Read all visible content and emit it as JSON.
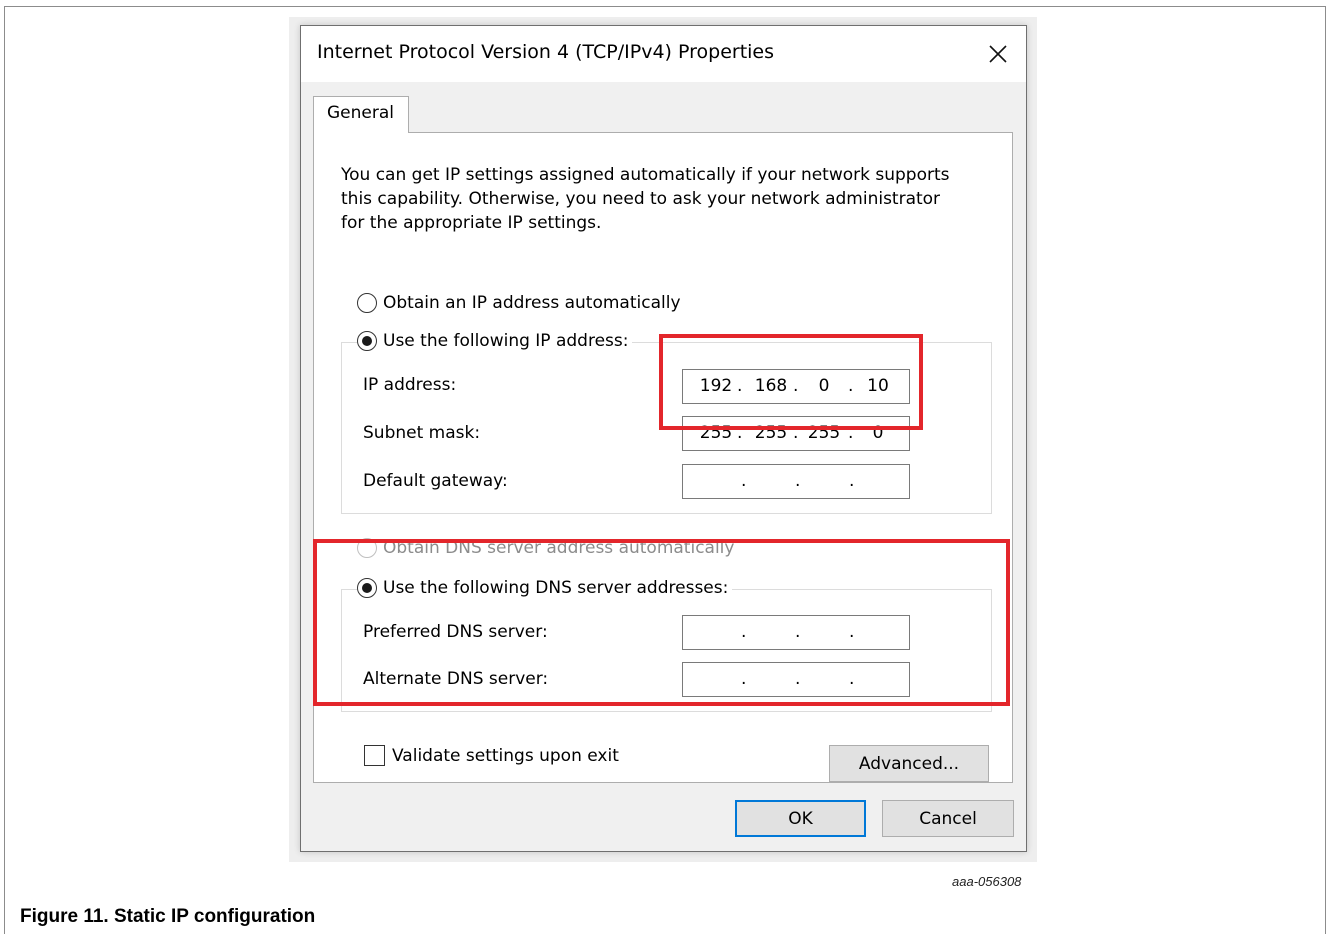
{
  "dialog": {
    "title": "Internet Protocol Version 4 (TCP/IPv4) Properties",
    "close_icon": "close-icon",
    "tab_general": "General",
    "description": "You can get IP settings assigned automatically if your network supports\nthis capability. Otherwise, you need to ask your network administrator\nfor the appropriate IP settings.",
    "ip_mode": {
      "auto_label": "Obtain an IP address automatically",
      "auto_selected": false,
      "manual_label": "Use the following IP address:",
      "manual_selected": true
    },
    "ip_fields": {
      "ip_label": "IP address:",
      "ip_octets": [
        "192",
        "168",
        "0",
        "10"
      ],
      "subnet_label": "Subnet mask:",
      "subnet_octets": [
        "255",
        "255",
        "255",
        "0"
      ],
      "gateway_label": "Default gateway:",
      "gateway_octets": [
        "",
        "",
        "",
        ""
      ]
    },
    "dns_mode": {
      "auto_label": "Obtain DNS server address automatically",
      "auto_enabled": false,
      "manual_label": "Use the following DNS server addresses:",
      "manual_selected": true
    },
    "dns_fields": {
      "preferred_label": "Preferred DNS server:",
      "alternate_label": "Alternate DNS server:"
    },
    "validate_label": "Validate settings upon exit",
    "validate_checked": false,
    "advanced_label": "Advanced...",
    "ok_label": "OK",
    "cancel_label": "Cancel"
  },
  "figure": {
    "id": "aaa-056308",
    "caption": "Figure 11.  Static IP configuration"
  },
  "colors": {
    "highlight": "#e3262b",
    "default_button_border": "#0078d7",
    "dialog_bg": "#f0f0f0"
  }
}
